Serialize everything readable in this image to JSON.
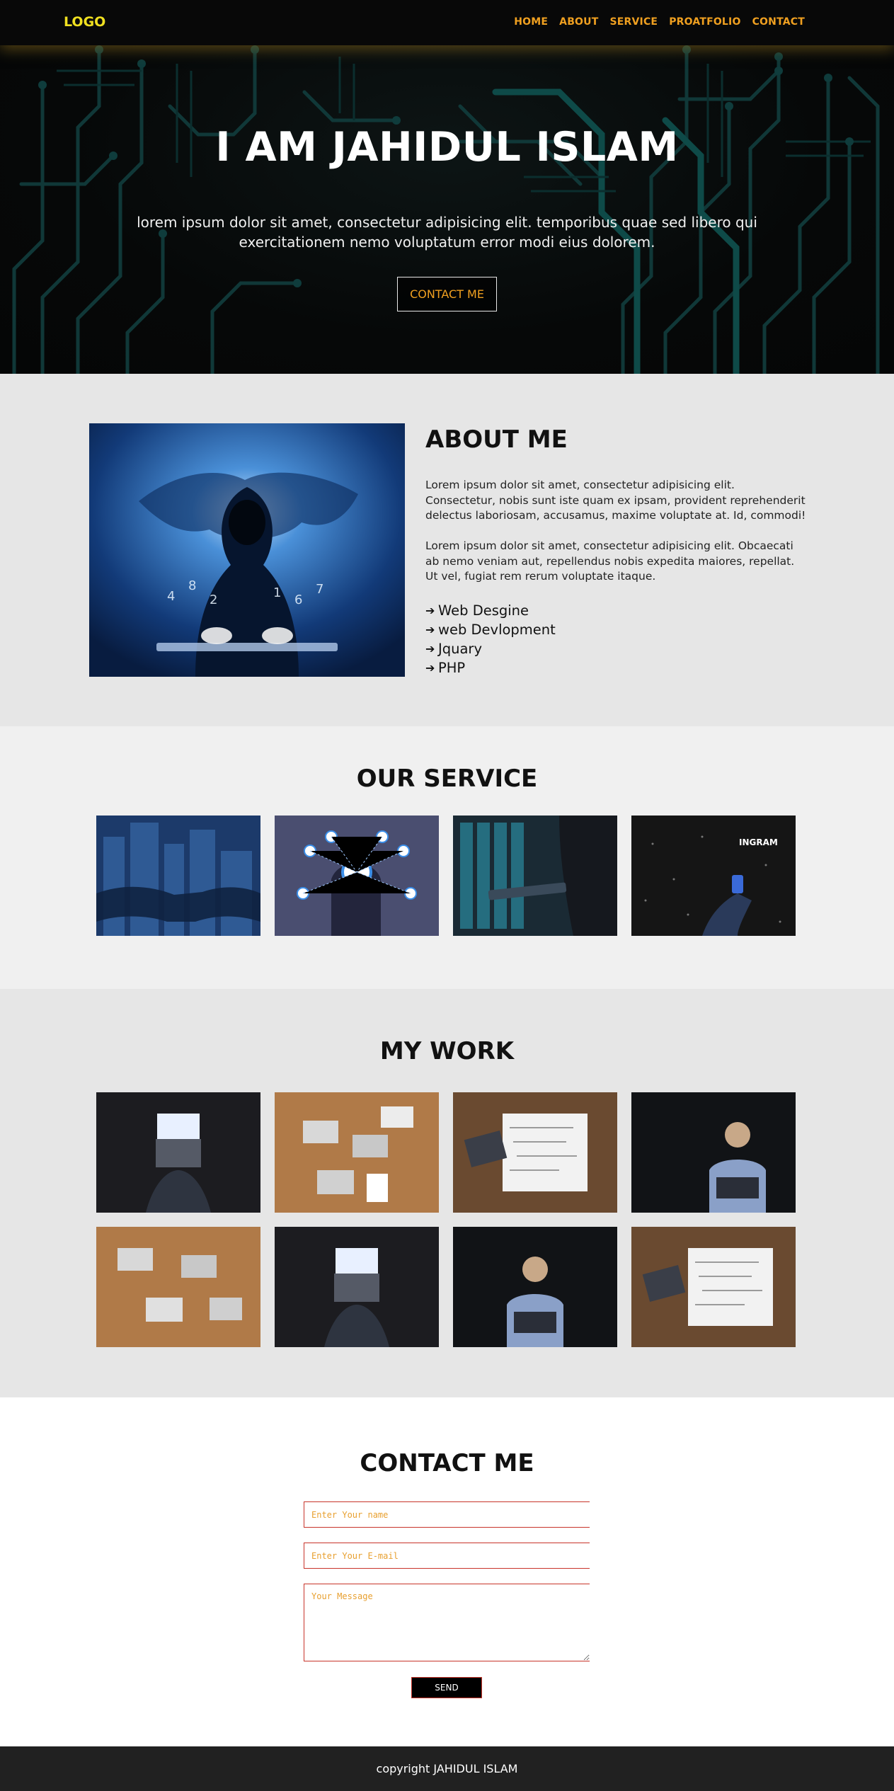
{
  "nav": {
    "logo": "LOGO",
    "items": [
      {
        "label": "HOME"
      },
      {
        "label": "ABOUT"
      },
      {
        "label": "SERVICE"
      },
      {
        "label": "PROATFOLIO"
      },
      {
        "label": "CONTACT"
      }
    ]
  },
  "hero": {
    "title": "I AM JAHIDUL ISLAM",
    "text": "lorem ipsum dolor sit amet, consectetur adipisicing elit. temporibus quae sed libero qui exercitationem nemo voluptatum error modi eius dolorem.",
    "button": "CONTACT ME"
  },
  "about": {
    "title": "ABOUT ME",
    "paragraphs": [
      "Lorem ipsum dolor sit amet, consectetur adipisicing elit. Consectetur, nobis sunt iste quam ex ipsam, provident reprehenderit delectus laboriosam, accusamus, maxime voluptate at. Id, commodi!",
      "Lorem ipsum dolor sit amet, consectetur adipisicing elit. Obcaecati ab nemo veniam aut, repellendus nobis expedita maiores, repellat. Ut vel, fugiat rem rerum voluptate itaque."
    ],
    "skills": [
      {
        "label": "Web Desgine"
      },
      {
        "label": "web Devlopment"
      },
      {
        "label": "Jquary"
      },
      {
        "label": "PHP"
      }
    ]
  },
  "service": {
    "title": "OUR SERVICE",
    "badge_text": "INGRAM"
  },
  "work": {
    "title": "MY WORK"
  },
  "contact": {
    "title": "CONTACT ME",
    "name_placeholder": "Enter Your name",
    "email_placeholder": "Enter Your E-mail",
    "message_placeholder": "Your Message",
    "send": "SEND"
  },
  "footer": {
    "text": "copyright JAHIDUL ISLAM"
  },
  "colors": {
    "accent": "#f0a020",
    "logo": "#f0e020",
    "field_border": "#c8342a"
  }
}
